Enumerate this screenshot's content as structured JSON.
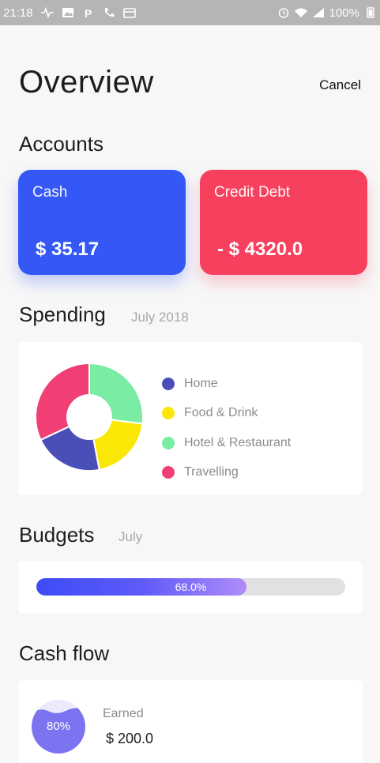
{
  "status_bar": {
    "time": "21:18",
    "battery": "100%",
    "left_icons": [
      "activity-icon",
      "image-icon",
      "p-icon",
      "phone-icon",
      "calendar-icon"
    ],
    "right_icons": [
      "alarm-icon",
      "wifi-icon",
      "signal-icon",
      "battery-icon"
    ]
  },
  "header": {
    "title": "Overview",
    "cancel_label": "Cancel"
  },
  "accounts": {
    "title": "Accounts",
    "cards": [
      {
        "label": "Cash",
        "amount": "$ 35.17",
        "color": "#3557f5"
      },
      {
        "label": "Credit Debt",
        "amount": "- $ 4320.0",
        "color": "#f6405e"
      }
    ]
  },
  "spending": {
    "title": "Spending",
    "period": "July 2018",
    "legend": [
      {
        "label": "Home",
        "color": "#4a4fb8"
      },
      {
        "label": "Food & Drink",
        "color": "#fbe706"
      },
      {
        "label": "Hotel & Restaurant",
        "color": "#7aeca4"
      },
      {
        "label": "Travelling",
        "color": "#f13f76"
      }
    ]
  },
  "chart_data": {
    "type": "pie",
    "categories": [
      "Hotel & Restaurant",
      "Food & Drink",
      "Home",
      "Travelling"
    ],
    "values": [
      27,
      20,
      21,
      32
    ],
    "colors": [
      "#7aeca4",
      "#fbe706",
      "#4a4fb8",
      "#f13f76"
    ],
    "donut": true
  },
  "budgets": {
    "title": "Budgets",
    "period": "July",
    "progress_percent": 68.0,
    "progress_label": "68.0%"
  },
  "cash_flow": {
    "title": "Cash flow",
    "gauge_percent": 80,
    "gauge_label": "80%",
    "earned_label": "Earned",
    "earned_amount": "$ 200.0"
  }
}
